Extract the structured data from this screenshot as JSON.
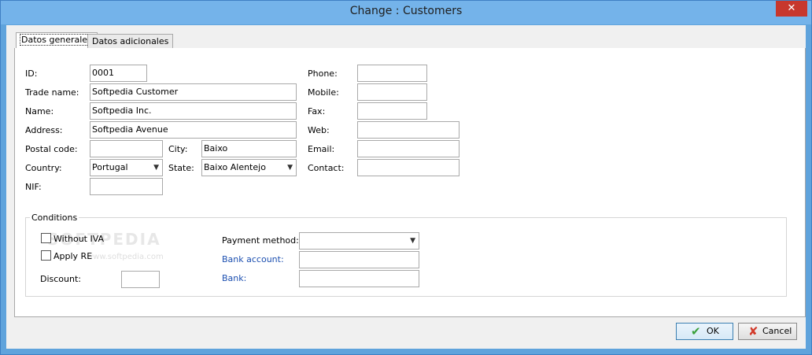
{
  "window": {
    "title": "Change : Customers",
    "close_symbol": "✕"
  },
  "tabs": [
    {
      "label": "Datos generales",
      "active": true
    },
    {
      "label": "Datos adicionales",
      "active": false
    }
  ],
  "form": {
    "id": {
      "label": "ID:",
      "value": "0001"
    },
    "trade_name": {
      "label": "Trade name:",
      "value": "Softpedia Customer"
    },
    "name": {
      "label": "Name:",
      "value": "Softpedia Inc."
    },
    "address": {
      "label": "Address:",
      "value": "Softpedia Avenue"
    },
    "postal_code": {
      "label": "Postal code:",
      "value": ""
    },
    "city": {
      "label": "City:",
      "value": "Baixo"
    },
    "country": {
      "label": "Country:",
      "value": "Portugal"
    },
    "state": {
      "label": "State:",
      "value": "Baixo Alentejo"
    },
    "nif": {
      "label": "NIF:",
      "value": ""
    },
    "phone": {
      "label": "Phone:",
      "value": ""
    },
    "mobile": {
      "label": "Mobile:",
      "value": ""
    },
    "fax": {
      "label": "Fax:",
      "value": ""
    },
    "web": {
      "label": "Web:",
      "value": ""
    },
    "email": {
      "label": "Email:",
      "value": ""
    },
    "contact": {
      "label": "Contact:",
      "value": ""
    }
  },
  "conditions": {
    "title": "Conditions",
    "without_iva": {
      "label": "Without IVA",
      "checked": false
    },
    "apply_re": {
      "label": "Apply RE",
      "checked": false
    },
    "discount": {
      "label": "Discount:",
      "value": ""
    },
    "payment_method": {
      "label": "Payment method:",
      "value": ""
    },
    "bank_account": {
      "label": "Bank account:",
      "value": ""
    },
    "bank": {
      "label": "Bank:",
      "value": ""
    }
  },
  "watermark": {
    "main": "SOFTPEDIA",
    "sub": "www.softpedia.com"
  },
  "buttons": {
    "ok": {
      "label": "OK",
      "icon": "check-icon",
      "color": "#3aa03a"
    },
    "cancel": {
      "label": "Cancel",
      "icon": "cross-icon",
      "color": "#d23a2a"
    }
  }
}
